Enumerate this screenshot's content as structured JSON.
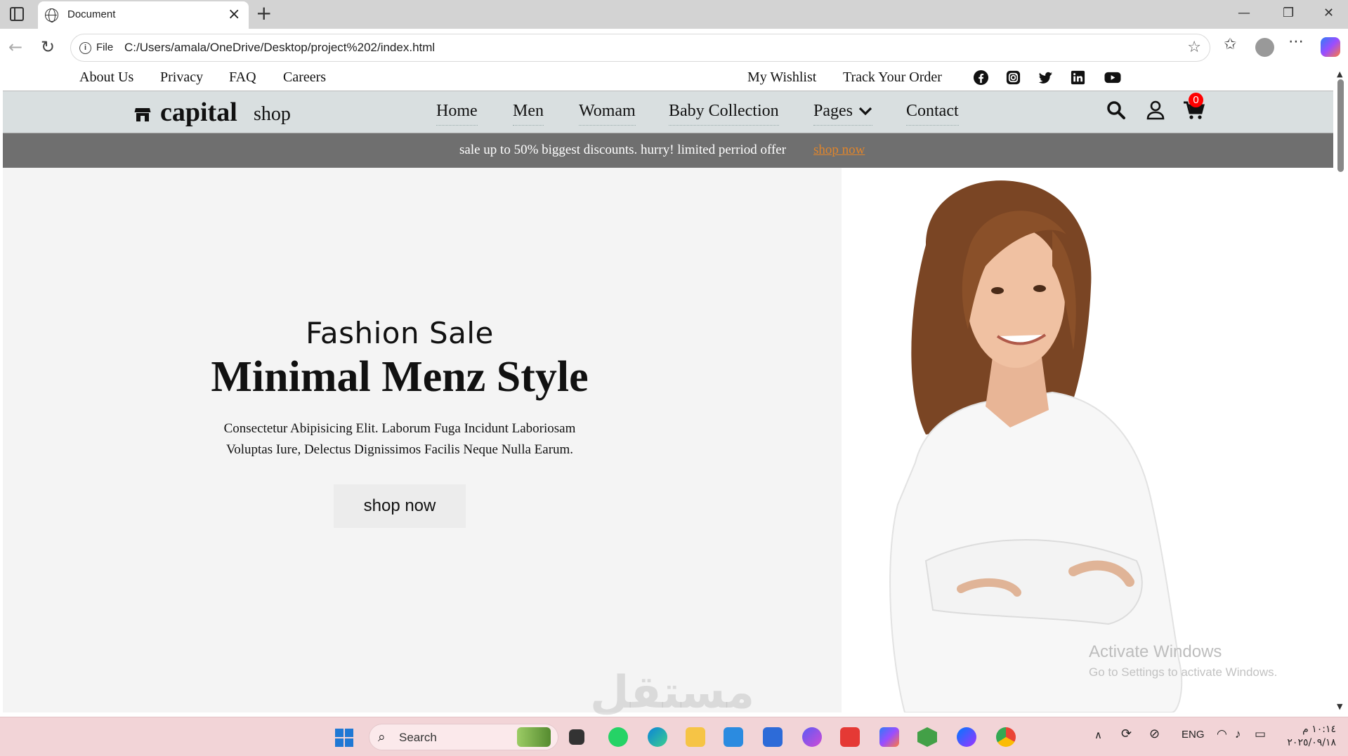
{
  "browser": {
    "tab_title": "Document",
    "url_scheme_label": "File",
    "url": "C:/Users/amala/OneDrive/Desktop/project%202/index.html"
  },
  "topbar": {
    "left_links": [
      "About Us",
      "Privacy",
      "FAQ",
      "Careers"
    ],
    "right_links": [
      "My Wishlist",
      "Track Your Order"
    ],
    "social_icons": [
      "facebook-icon",
      "instagram-icon",
      "twitter-icon",
      "linkedin-icon",
      "youtube-icon"
    ]
  },
  "nav": {
    "logo_main": "capital",
    "logo_sub": "shop",
    "links": [
      "Home",
      "Men",
      "Womam",
      "Baby Collection",
      "Pages",
      "Contact"
    ],
    "cart_count": "0"
  },
  "sale": {
    "text": "sale up to 50% biggest discounts. hurry! limited perriod offer",
    "link": "shop now",
    "link_color": "#e0852c"
  },
  "hero": {
    "subtitle": "Fashion Sale",
    "title": "Minimal Menz Style",
    "description_line1": "Consectetur Abipisicing Elit. Laborum Fuga Incidunt Laboriosam",
    "description_line2": "Voluptas Iure, Delectus Dignissimos Facilis Neque Nulla Earum.",
    "button": "shop now"
  },
  "overlay": {
    "activate_title": "Activate Windows",
    "activate_sub": "Go to Settings to activate Windows.",
    "watermark": "مستقل"
  },
  "taskbar": {
    "search_label": "Search",
    "language": "ENG",
    "time": "١٠:١٤ م",
    "date": "٢٠٢٥/٠٩/١٨"
  },
  "colors": {
    "nav_bg": "#d9dfe0",
    "sale_bg": "#6f6f6f",
    "hero_bg": "#f4f4f4",
    "taskbar_bg": "#f2d4d7"
  }
}
